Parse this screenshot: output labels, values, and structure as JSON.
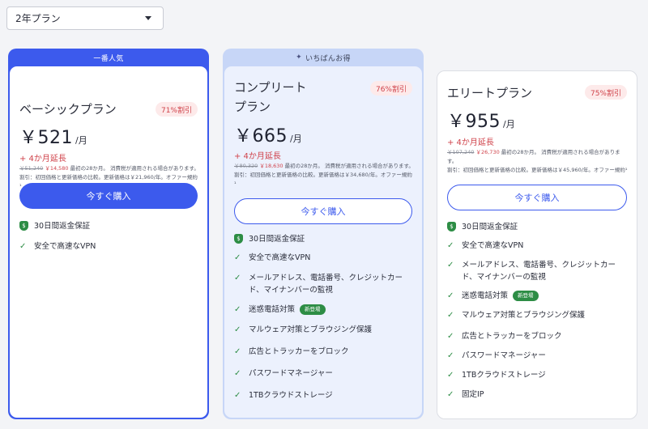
{
  "select": {
    "value": "2年プラン"
  },
  "plans": [
    {
      "banner": "一番人気",
      "name": "ベーシックプラン",
      "discount": "71%割引",
      "price": "￥521",
      "per": "/月",
      "extension": "+ 4か月延長",
      "original_price": "￥51,240",
      "sale_price": "￥14,580",
      "fine_rest1": " 最初の28か月。 消費税が適用される場合があります。",
      "fine_rest2": "割引：初回価格と更新価格の比較。更新価格は￥21,960/年。オファー規約¹",
      "button": "今すぐ購入",
      "guarantee": "30日間返金保証",
      "features": [
        "安全で高速なVPN"
      ]
    },
    {
      "banner": "いちばんお得",
      "name_line1": "コンプリート",
      "name_line2": "プラン",
      "discount": "76%割引",
      "price": "￥665",
      "per": "/月",
      "extension": "+ 4か月延長",
      "original_price": "￥80,320",
      "sale_price": "￥18,630",
      "fine_rest1": " 最初の28か月。 消費税が適用される場合があります。",
      "fine_rest2": "割引：初回価格と更新価格の比較。更新価格は￥34,680/年。オファー規約¹",
      "button": "今すぐ購入",
      "guarantee": "30日間返金保証",
      "features": [
        "安全で高速なVPN",
        "メールアドレス、電話番号、クレジットカード、マイナンバーの監視",
        "迷惑電話対策",
        "マルウェア対策とブラウジング保護",
        "広告とトラッカーをブロック",
        "パスワードマネージャー",
        "1TBクラウドストレージ"
      ],
      "new_badge": "新登場"
    },
    {
      "name": "エリートプラン",
      "discount": "75%割引",
      "price": "￥955",
      "per": "/月",
      "extension": "+ 4か月延長",
      "original_price": "￥107,240",
      "sale_price": "￥26,730",
      "fine_rest1": " 最初の28か月。 消費税が適用される場合があります。",
      "fine_rest2": "割引：初回価格と更新価格の比較。更新価格は￥45,960/年。オファー規約¹",
      "button": "今すぐ購入",
      "guarantee": "30日間返金保証",
      "features": [
        "安全で高速なVPN",
        "メールアドレス、電話番号、クレジットカード、マイナンバーの監視",
        "迷惑電話対策",
        "マルウェア対策とブラウジング保護",
        "広告とトラッカーをブロック",
        "パスワードマネージャー",
        "1TBクラウドストレージ",
        "固定IP"
      ],
      "new_badge": "新登場"
    }
  ],
  "colors": {
    "accent": "#3c5aed",
    "discount": "#d0434b",
    "check": "#2d8d45",
    "highlight_bg": "#ecf1fd"
  },
  "icons": {
    "select_caret": "chevron-down-icon",
    "banner_icon": "sparkle-icon",
    "guarantee": "shield-icon",
    "feature": "check-icon"
  }
}
